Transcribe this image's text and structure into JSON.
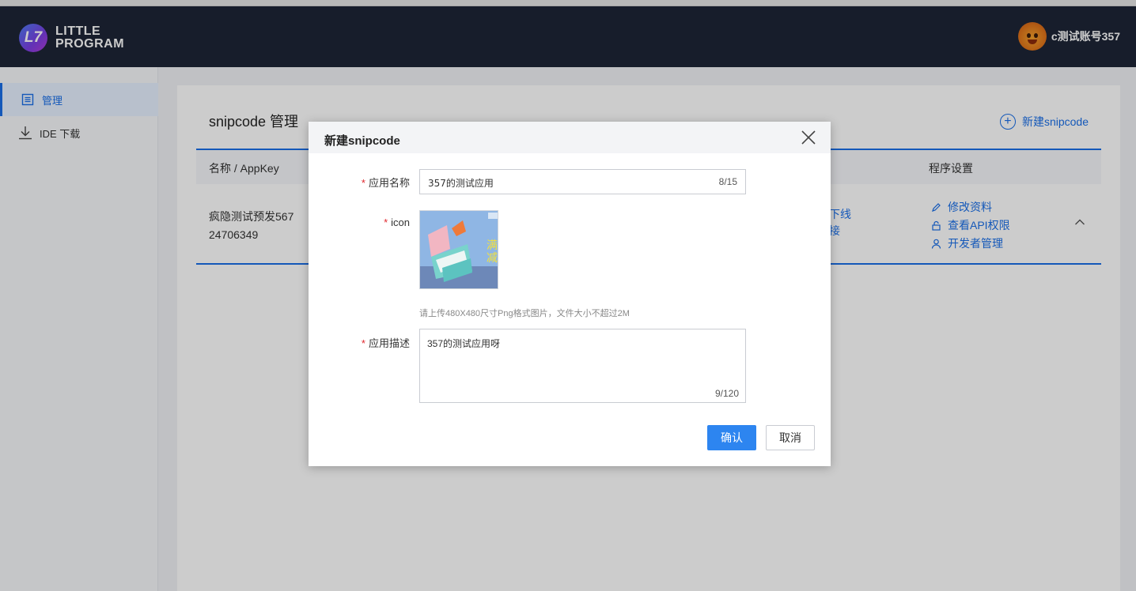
{
  "header": {
    "logo_line1": "LITTLE",
    "logo_line2": "PROGRAM",
    "logo_mark": "L7",
    "user_name": "c测试账号357"
  },
  "sidebar": {
    "items": [
      {
        "label": "管理",
        "icon": "list-icon",
        "active": true
      },
      {
        "label": "IDE 下载",
        "icon": "download-icon",
        "active": false
      }
    ]
  },
  "main": {
    "title": "snipcode 管理",
    "new_button": "新建snipcode",
    "table": {
      "headers": [
        "名称 / AppKey",
        "程序设置"
      ],
      "rows": [
        {
          "name": "疯隐测试预发567",
          "appkey": "24706349",
          "mid_line1": "下线",
          "mid_line2": "接",
          "ops": [
            "修改资料",
            "查看API权限",
            "开发者管理"
          ]
        }
      ]
    }
  },
  "modal": {
    "title": "新建snipcode",
    "fields": {
      "name_label": "应用名称",
      "name_value": "357的测试应用",
      "name_counter": "8/15",
      "icon_label": "icon",
      "icon_hint": "请上传480X480尺寸Png格式图片，文件大小不超过2M",
      "icon_overlay_text": "满减",
      "desc_label": "应用描述",
      "desc_value": "357的测试应用呀",
      "desc_counter": "9/120"
    },
    "confirm_label": "确认",
    "cancel_label": "取消"
  },
  "colors": {
    "header_bg": "#1d2536",
    "accent": "#1a6fe8",
    "required": "#e0282e",
    "confirm_bg": "#2d85f0"
  }
}
